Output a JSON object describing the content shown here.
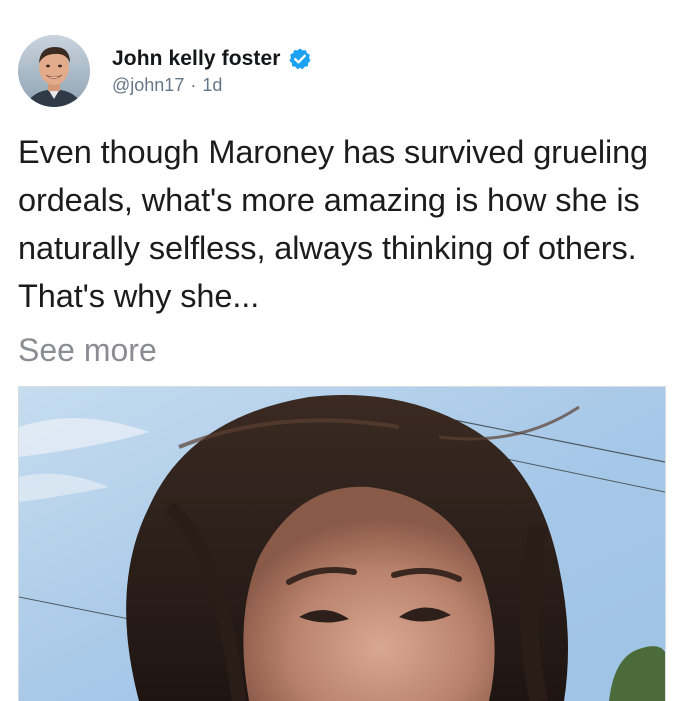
{
  "tweet": {
    "author": {
      "display_name": "John kelly foster",
      "handle": "@john17",
      "verified": true,
      "avatar_icon": "profile-photo"
    },
    "separator": "·",
    "timestamp": "1d",
    "text": "Even though Maroney has survived grueling ordeals, what's more amazing is how she is naturally selfless, always thinking of others. That's why she...",
    "see_more_label": "See more",
    "media": {
      "type": "photo",
      "description_icon": "selfie-photo"
    }
  },
  "colors": {
    "verified_badge": "#1da1f2",
    "handle_gray": "#657786",
    "see_more_gray": "#8a8d91",
    "text": "#1c1c1c"
  }
}
